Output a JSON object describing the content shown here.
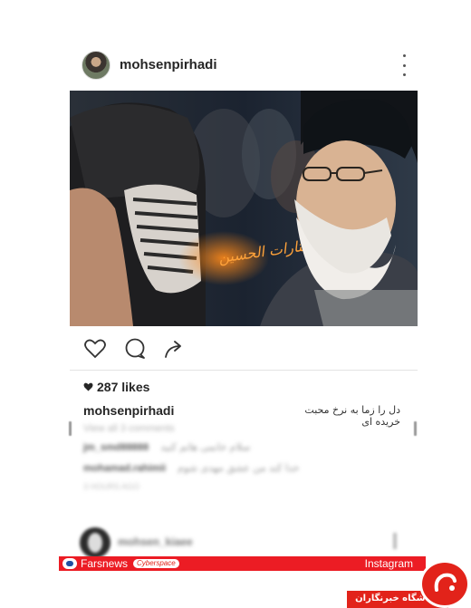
{
  "post": {
    "username": "mohsenpirhadi",
    "image_calligraphy": "یا لثارات الحسین",
    "likes": "287 likes",
    "caption_user": "mohsenpirhadi",
    "caption_text": "دل را زما به نرخ محبت خریده ای",
    "view_comments": "View all 3 comments",
    "comments": [
      {
        "user": "jm_smd88888",
        "text": "سلام خانمی هاتم کنید"
      },
      {
        "user": "mohamad.rahimii",
        "text": "خدا کند من عشق مهدی شوم"
      }
    ],
    "time_ago": "3 HOURS AGO"
  },
  "next_post": {
    "username": "mohsen_kiaee"
  },
  "footer": {
    "source": "Farsnews",
    "section": "Cyberspace",
    "platform": "Instagram"
  },
  "logo": {
    "text": "باشگاه خبرنگاران"
  },
  "colors": {
    "red": "#ec1c24",
    "text": "#262626",
    "image_bg": "#1a2027"
  },
  "icons": [
    "more-options-icon",
    "heart-icon",
    "comment-icon",
    "share-icon",
    "heart-small-icon"
  ]
}
